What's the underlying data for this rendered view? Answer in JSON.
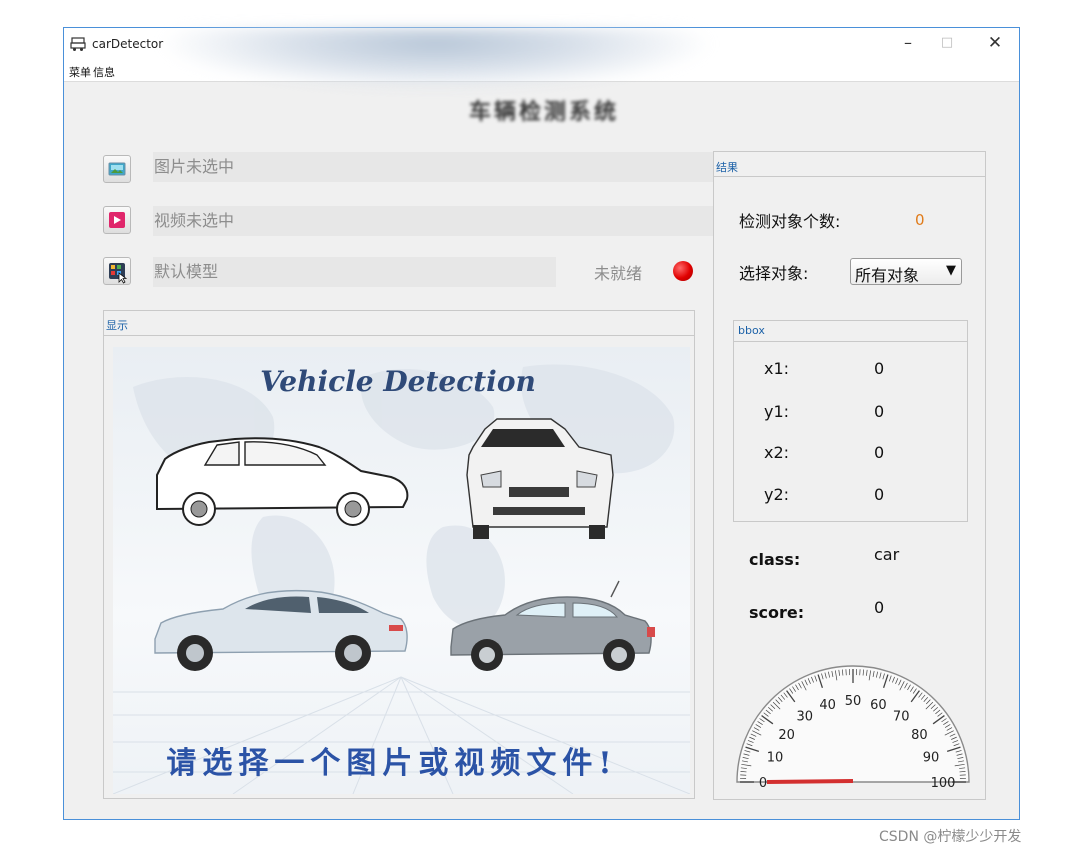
{
  "window": {
    "title": "carDetector",
    "heading": "车辆检测系统",
    "controls": {
      "minimize": "–",
      "maximize": "□",
      "close": "✕"
    },
    "menu": [
      "菜单",
      "信息"
    ]
  },
  "inputs": {
    "image": {
      "text": "图片未选中",
      "icon": "image-icon"
    },
    "video": {
      "text": "视频未选中",
      "icon": "video-icon"
    },
    "model": {
      "text": "默认模型",
      "icon": "model-icon",
      "status": "未就绪",
      "status_color": "#e00000"
    }
  },
  "display": {
    "label": "显示",
    "banner_title": "Vehicle Detection",
    "prompt": "请选择一个图片或视频文件!"
  },
  "results": {
    "label": "结果",
    "count_label": "检测对象个数:",
    "count_value": "0",
    "select_label": "选择对象:",
    "select_value": "所有对象",
    "bbox": {
      "label": "bbox",
      "rows": [
        {
          "key": "x1:",
          "value": "0"
        },
        {
          "key": "y1:",
          "value": "0"
        },
        {
          "key": "x2:",
          "value": "0"
        },
        {
          "key": "y2:",
          "value": "0"
        }
      ]
    },
    "class_label": "class:",
    "class_value": "car",
    "score_label": "score:",
    "score_value": "0",
    "gauge": {
      "min": 0,
      "max": 100,
      "value": 0,
      "tick_labels": [
        "0",
        "10",
        "20",
        "30",
        "40",
        "50",
        "60",
        "70",
        "80",
        "90",
        "100"
      ],
      "indicator_color": "#d32f2f"
    }
  },
  "colors": {
    "accent_label": "#1d62a8",
    "count_value": "#e07b1a",
    "window_border": "#4a90d9"
  },
  "watermark": "CSDN @柠檬少少开发"
}
